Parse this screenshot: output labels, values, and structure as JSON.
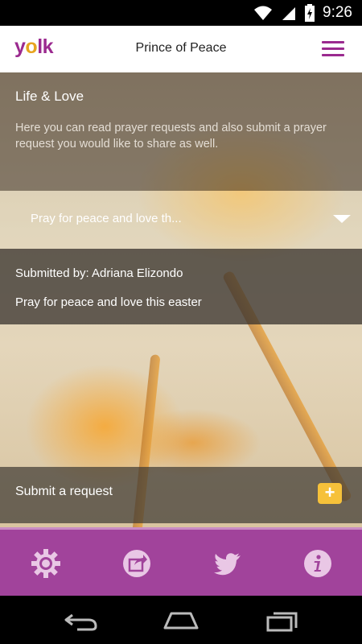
{
  "status_bar": {
    "time": "9:26"
  },
  "header": {
    "logo_text": "yolk",
    "title": "Prince of Peace"
  },
  "intro": {
    "title": "Life & Love",
    "description": "Here you can read prayer requests and also submit a prayer request you would like to share as well."
  },
  "dropdown": {
    "selected": "Pray for peace and love th..."
  },
  "detail": {
    "submitted_by": "Submitted by: Adriana Elizondo",
    "text": "Pray for peace and love this easter"
  },
  "submit": {
    "label": "Submit a request",
    "button_symbol": "+"
  },
  "action_bar": {
    "items": [
      {
        "icon": "gear-icon"
      },
      {
        "icon": "share-icon"
      },
      {
        "icon": "twitter-icon"
      },
      {
        "icon": "info-icon"
      }
    ]
  },
  "colors": {
    "brand_purple": "#9b2a8f",
    "action_bar": "#a1439b",
    "accent_yellow": "#f6c13a"
  }
}
